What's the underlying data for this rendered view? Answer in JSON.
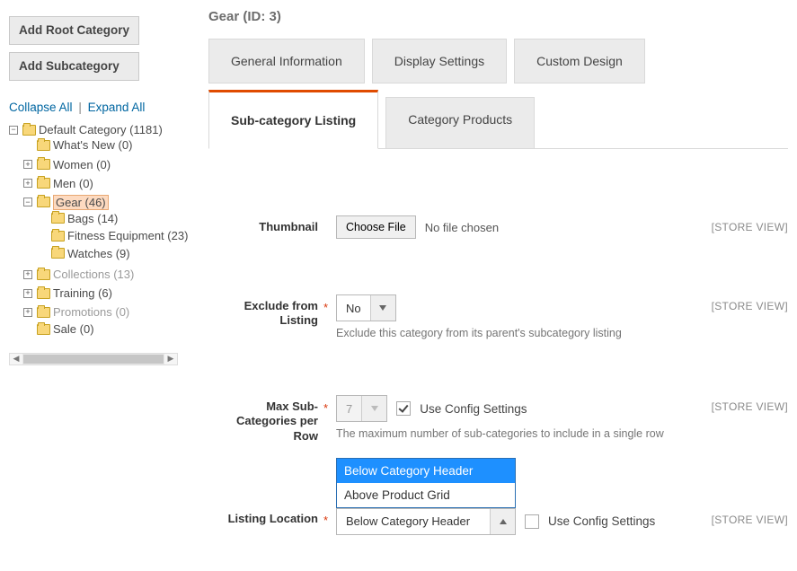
{
  "sidebar": {
    "add_root_label": "Add Root Category",
    "add_sub_label": "Add Subcategory",
    "collapse_label": "Collapse All",
    "expand_label": "Expand All",
    "tree": {
      "root": "Default Category (1181)",
      "items": [
        {
          "label": "What's New (0)",
          "expander": "",
          "muted": false
        },
        {
          "label": "Women (0)",
          "expander": "+",
          "muted": false
        },
        {
          "label": "Men (0)",
          "expander": "+",
          "muted": false
        },
        {
          "label": "Gear (46)",
          "expander": "−",
          "selected": true,
          "children": [
            {
              "label": "Bags (14)"
            },
            {
              "label": "Fitness Equipment (23)"
            },
            {
              "label": "Watches (9)"
            }
          ]
        },
        {
          "label": "Collections (13)",
          "expander": "+",
          "muted": true
        },
        {
          "label": "Training (6)",
          "expander": "+",
          "muted": false
        },
        {
          "label": "Promotions (0)",
          "expander": "+",
          "muted": true
        },
        {
          "label": "Sale (0)",
          "expander": "",
          "muted": false
        }
      ]
    }
  },
  "page": {
    "title": "Gear (ID: 3)"
  },
  "tabs": {
    "general": "General Information",
    "display": "Display Settings",
    "custom": "Custom Design",
    "sub_listing": "Sub-category Listing",
    "products": "Category Products"
  },
  "form": {
    "scope_label": "[STORE VIEW]",
    "thumbnail": {
      "label": "Thumbnail",
      "choose": "Choose File",
      "status": "No file chosen"
    },
    "exclude": {
      "label": "Exclude from Listing",
      "value": "No",
      "hint": "Exclude this category from its parent's subcategory listing"
    },
    "maxrow": {
      "label": "Max Sub-Categories per Row",
      "value": "7",
      "use_config_label": "Use Config Settings",
      "hint": "The maximum number of sub-categories to include in a single row"
    },
    "location": {
      "label": "Listing Location",
      "value": "Below Category Header",
      "options": [
        "Below Category Header",
        "Above Product Grid"
      ],
      "use_config_label": "Use Config Settings"
    }
  }
}
